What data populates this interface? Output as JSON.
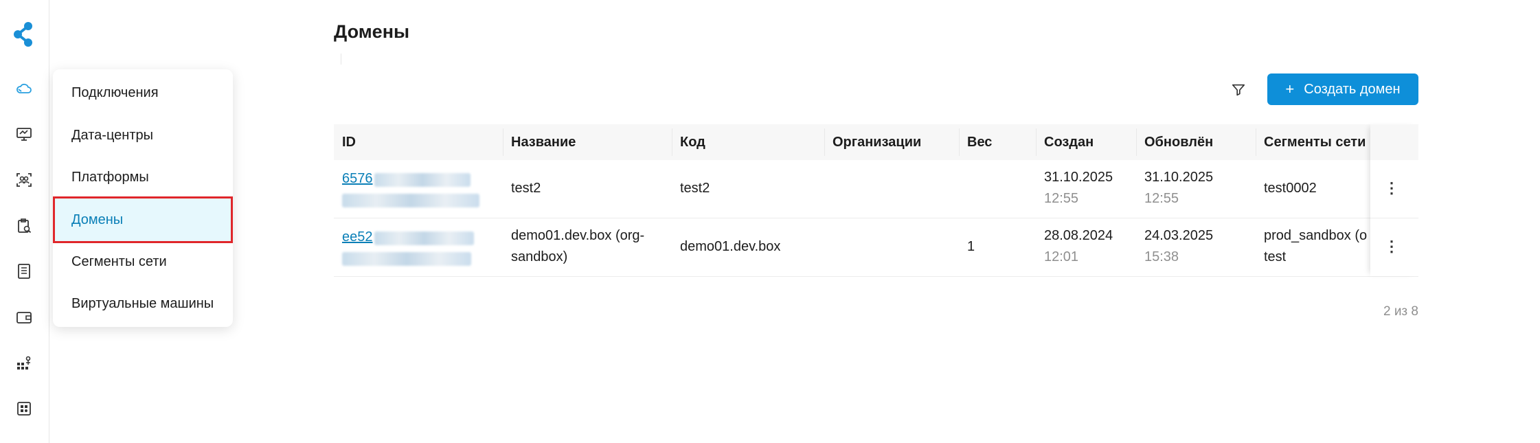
{
  "flyout": {
    "items": [
      {
        "label": "Подключения"
      },
      {
        "label": "Дата-центры"
      },
      {
        "label": "Платформы"
      },
      {
        "label": "Домены"
      },
      {
        "label": "Сегменты сети"
      },
      {
        "label": "Виртуальные машины"
      }
    ],
    "active": "Домены"
  },
  "rail": {
    "icons": [
      "logo-icon",
      "cloud-icon",
      "monitor-icon",
      "users-icon",
      "clipboard-icon",
      "list-icon",
      "wallet-icon",
      "network-icon",
      "apps-icon"
    ]
  },
  "page": {
    "title": "Домены",
    "create_button": "Создать домен"
  },
  "table": {
    "columns": [
      "ID",
      "Название",
      "Код",
      "Организации",
      "Вес",
      "Создан",
      "Обновлён",
      "Сегменты сети"
    ],
    "rows": [
      {
        "id_prefix": "6576",
        "name_line1": "test2",
        "name_line2": "",
        "code": "test2",
        "orgs": "",
        "weight": "",
        "created_date": "31.10.2025",
        "created_time": "12:55",
        "updated_date": "31.10.2025",
        "updated_time": "12:55",
        "segments_line1": "test0002",
        "segments_line2": ""
      },
      {
        "id_prefix": "ee52",
        "name_line1": "demo01.dev.box (org-",
        "name_line2": "sandbox)",
        "code": "demo01.dev.box",
        "orgs": "",
        "weight": "1",
        "created_date": "28.08.2024",
        "created_time": "12:01",
        "updated_date": "24.03.2025",
        "updated_time": "15:38",
        "segments_line1": "prod_sandbox (o",
        "segments_line2": "test"
      }
    ]
  },
  "pagination": {
    "text": "2 из 8"
  },
  "colors": {
    "accent": "#0e8fd9",
    "active_bg": "#e6f8fd",
    "active_text": "#0a7fb7",
    "highlight_border": "#e0262a"
  }
}
